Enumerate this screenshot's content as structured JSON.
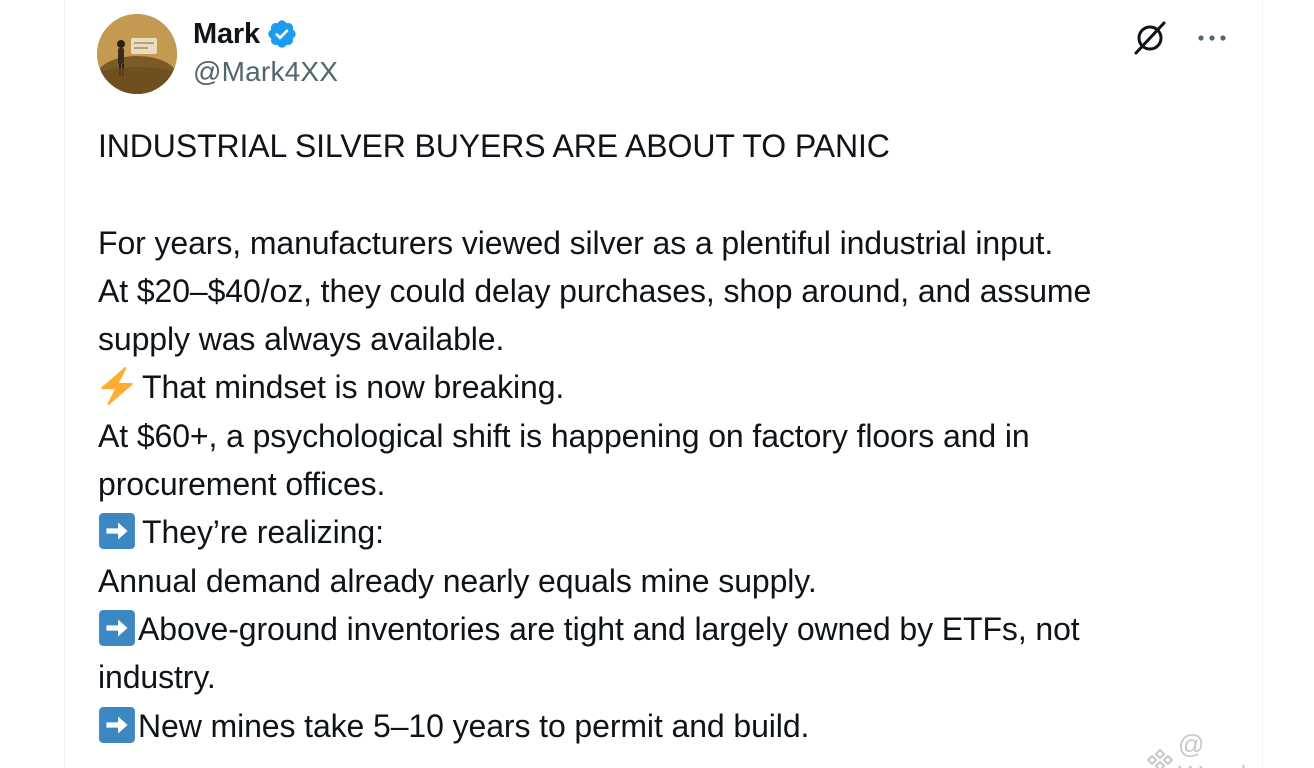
{
  "author": {
    "display_name": "Mark",
    "handle": "@Mark4XX",
    "avatar_icon": "avatar-image",
    "verified_icon": "verified-badge-icon",
    "verified_color": "#1d9bf0"
  },
  "actions": {
    "grok_icon": "grok-icon",
    "more_icon": "more-icon"
  },
  "post": {
    "headline": "INDUSTRIAL SILVER BUYERS ARE ABOUT TO PANIC",
    "lines": [
      "For years, manufacturers viewed silver as a plentiful industrial input.",
      "At $20–$40/oz, they could delay purchases, shop around, and assume",
      "supply was always available.",
      "That mindset is now breaking.",
      "At $60+, a psychological shift is happening on factory floors and in",
      "procurement offices.",
      "They’re realizing:",
      "Annual demand already nearly equals mine supply.",
      "Above-ground inventories are tight and largely owned by ETFs, not",
      "industry.",
      "New mines take 5–10 years to permit and build."
    ],
    "emojis": {
      "lightning": "high-voltage-emoji",
      "arrow": "right-arrow-emoji"
    }
  },
  "watermark": {
    "text": "@ Wendyy_",
    "icon": "binance-logo-icon",
    "color": "#c6c9cc"
  },
  "colors": {
    "text": "#0f1419",
    "secondary": "#536471",
    "arrow_bg": "#3b88c3",
    "lightning": "#ffac33"
  }
}
